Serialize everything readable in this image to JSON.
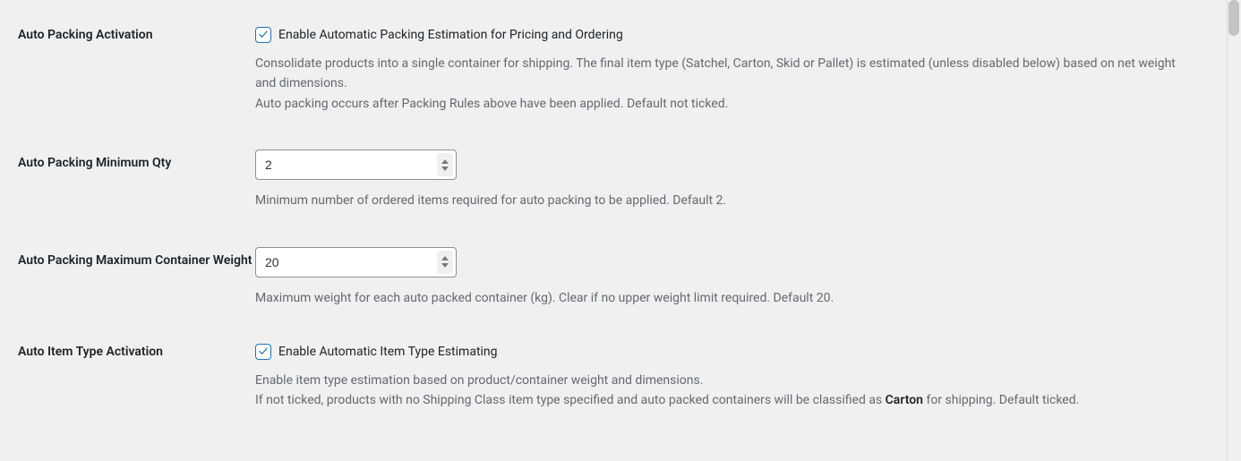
{
  "rows": {
    "activation": {
      "label": "Auto Packing Activation",
      "checkbox_label": "Enable Automatic Packing Estimation for Pricing and Ordering",
      "checked": true,
      "description_line1": "Consolidate products into a single container for shipping. The final item type (Satchel, Carton, Skid or Pallet) is estimated (unless disabled below) based on net weight and dimensions.",
      "description_line2": "Auto packing occurs after Packing Rules above have been applied. Default not ticked."
    },
    "min_qty": {
      "label": "Auto Packing Minimum Qty",
      "value": "2",
      "description": "Minimum number of ordered items required for auto packing to be applied. Default 2."
    },
    "max_weight": {
      "label": "Auto Packing Maximum Container Weight",
      "value": "20",
      "description": "Maximum weight for each auto packed container (kg). Clear if no upper weight limit required. Default 20."
    },
    "item_type": {
      "label": "Auto Item Type Activation",
      "checkbox_label": "Enable Automatic Item Type Estimating",
      "checked": true,
      "description_line1": "Enable item type estimation based on product/container weight and dimensions.",
      "description_line2_prefix": "If not ticked, products with no Shipping Class item type specified and auto packed containers will be classified as ",
      "description_line2_bold": "Carton",
      "description_line2_suffix": " for shipping. Default ticked."
    }
  }
}
